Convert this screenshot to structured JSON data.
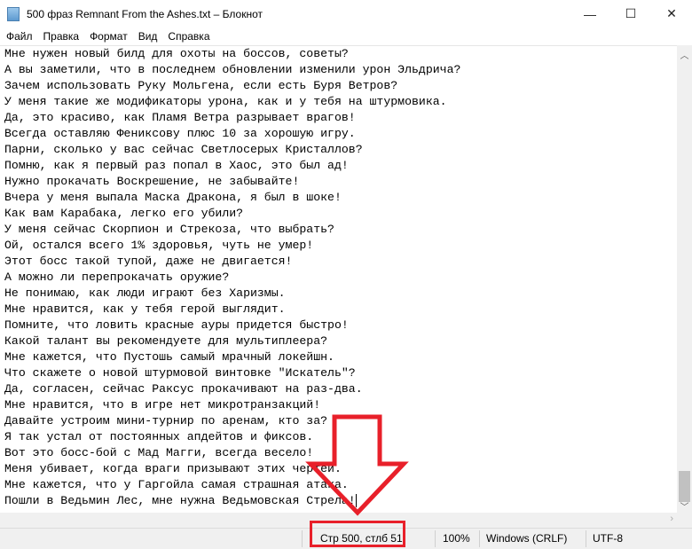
{
  "window": {
    "title": "500 фраз  Remnant From the Ashes.txt – Блокнот",
    "minimize": "—",
    "maximize": "☐",
    "close": "✕"
  },
  "menu": [
    "Файл",
    "Правка",
    "Формат",
    "Вид",
    "Справка"
  ],
  "lines": [
    "Мне нужен новый билд для охоты на боссов, советы?",
    "А вы заметили, что в последнем обновлении изменили урон Эльдрича?",
    "Зачем использовать Руку Мольгена, если есть Буря Ветров?",
    "У меня такие же модификаторы урона, как и у тебя на штурмовика.",
    "Да, это красиво, как Пламя Ветра разрывает врагов!",
    "Всегда оставляю Фениксову плюс 10 за хорошую игру.",
    "Парни, сколько у вас сейчас Светлосерых Кристаллов?",
    "Помню, как я первый раз попал в Хаос, это был ад!",
    "Нужно прокачать Воскрешение, не забывайте!",
    "Вчера у меня выпала Маска Дракона, я был в шоке!",
    "Как вам Карабака, легко его убили?",
    "У меня сейчас Скорпион и Стрекоза, что выбрать?",
    "Ой, остался всего 1% здоровья, чуть не умер!",
    "Этот босс такой тупой, даже не двигается!",
    "А можно ли перепрокачать оружие?",
    "Не понимаю, как люди играют без Харизмы.",
    "Мне нравится, как у тебя герой выглядит.",
    "Помните, что ловить красные ауры придется быстро!",
    "Какой талант вы рекомендуете для мультиплеера?",
    "Мне кажется, что Пустошь самый мрачный локейшн.",
    "Что скажете о новой штурмовой винтовке \"Искатель\"?",
    "Да, согласен, сейчас Раксус прокачивают на раз-два.",
    "Мне нравится, что в игре нет микротранзакций!",
    "Давайте устроим мини-турнир по аренам, кто за?",
    "Я так устал от постоянных апдейтов и фиксов.",
    "Вот это босс-бой с Мад Магги, всегда весело!",
    "Меня убивает, когда враги призывают этих чертей.",
    "Мне кажется, что у Гаргойла самая страшная атака.",
    "Пошли в Ведьмин Лес, мне нужна Ведьмовская Стрела!"
  ],
  "status": {
    "position": "Стр 500, стлб 51",
    "zoom": "100%",
    "line_endings": "Windows (CRLF)",
    "encoding": "UTF-8"
  },
  "annotation_color": "#e8202a"
}
